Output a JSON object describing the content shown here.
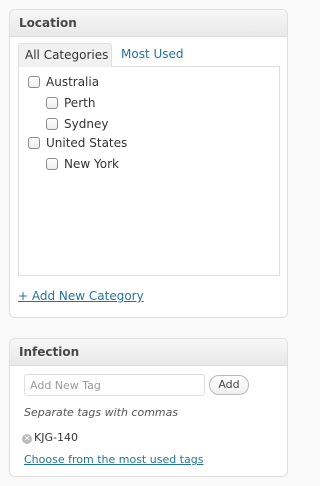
{
  "location_box": {
    "title": "Location",
    "tabs": [
      {
        "label": "All Categories",
        "active": true
      },
      {
        "label": "Most Used",
        "active": false
      }
    ],
    "categories": [
      {
        "label": "Australia",
        "checked": false,
        "level": 0
      },
      {
        "label": "Perth",
        "checked": false,
        "level": 1
      },
      {
        "label": "Sydney",
        "checked": false,
        "level": 1
      },
      {
        "label": "United States",
        "checked": false,
        "level": 0
      },
      {
        "label": "New York",
        "checked": false,
        "level": 1
      }
    ],
    "add_link": "+ Add New Category"
  },
  "infection_box": {
    "title": "Infection",
    "input_placeholder": "Add New Tag",
    "input_value": "",
    "add_button": "Add",
    "hint": "Separate tags with commas",
    "tags": [
      {
        "label": "KJG-140",
        "delete_icon": "x-circle-icon"
      }
    ],
    "choose_link": "Choose from the most used tags"
  },
  "colors": {
    "link": "#21759b",
    "border": "#dfdfdf",
    "background": "#f9f9f9"
  }
}
